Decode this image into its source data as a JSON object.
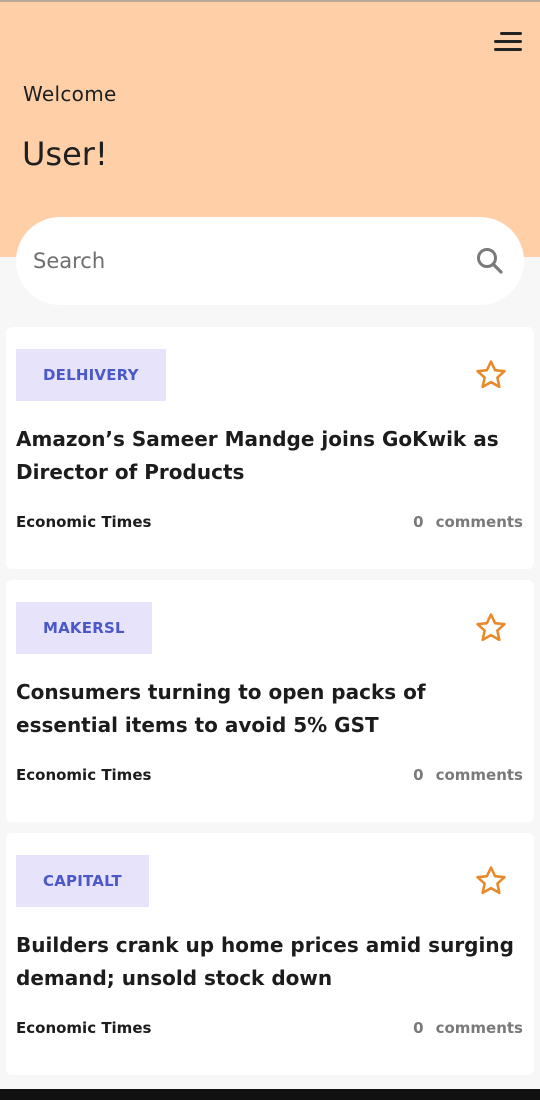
{
  "header": {
    "welcome_text": "Welcome",
    "username": "User!",
    "menu_icon": "hamburger-menu-icon",
    "background_color": "#ffcfa8"
  },
  "search": {
    "placeholder": "Search",
    "value": "",
    "icon": "search-icon"
  },
  "colors": {
    "tag_background": "#e6e3fb",
    "tag_text": "#4a58c8",
    "star": "#e8892b"
  },
  "articles": [
    {
      "tag": "DELHIVERY",
      "title": "Amazon’s Sameer Mandge joins GoKwik as Director of Products",
      "source": "Economic Times",
      "comment_count": "0",
      "comments_label": "comments",
      "bookmark_icon": "star-outline-icon"
    },
    {
      "tag": "MAKERSL",
      "title": "Consumers turning to open packs of essential items to avoid 5% GST",
      "source": "Economic Times",
      "comment_count": "0",
      "comments_label": "comments",
      "bookmark_icon": "star-outline-icon"
    },
    {
      "tag": "CAPITALT",
      "title": "Builders crank up home prices amid surging demand; unsold stock down",
      "source": "Economic Times",
      "comment_count": "0",
      "comments_label": "comments",
      "bookmark_icon": "star-outline-icon"
    }
  ]
}
